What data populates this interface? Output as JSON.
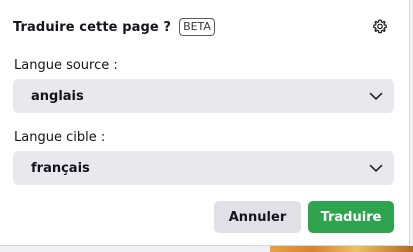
{
  "header": {
    "title": "Traduire cette page ?",
    "badge": "BETA",
    "settings_icon": "gear-icon"
  },
  "source": {
    "label": "Langue source :",
    "selected": "anglais"
  },
  "target": {
    "label": "Langue cible :",
    "selected": "français"
  },
  "buttons": {
    "cancel": "Annuler",
    "translate": "Traduire"
  },
  "colors": {
    "primary": "#2ea44f",
    "select_bg": "#e9e9ed",
    "secondary_button_bg": "#e0e0e6"
  }
}
